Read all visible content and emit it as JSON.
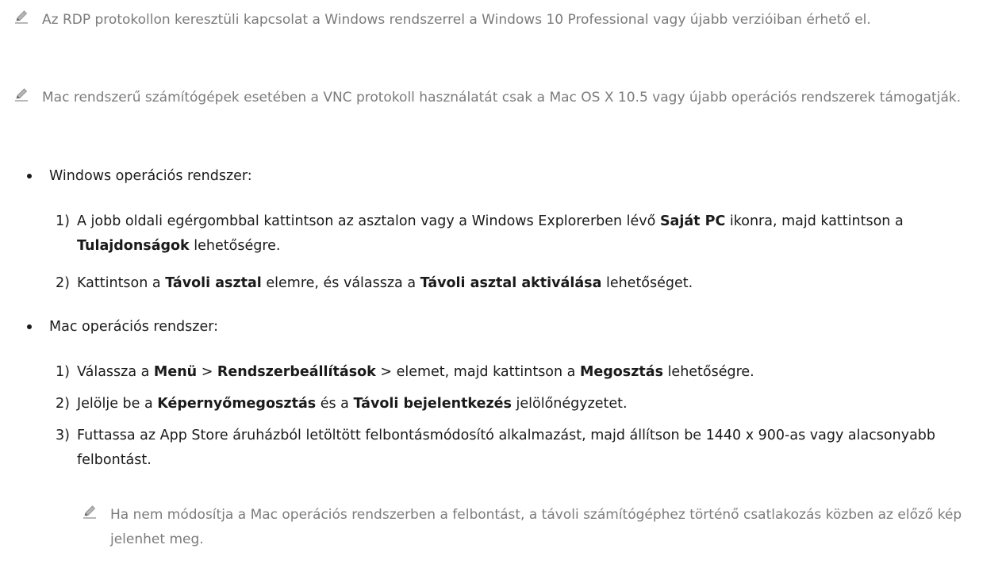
{
  "notes": {
    "rdp": "Az RDP protokollon keresztüli kapcsolat a Windows rendszerrel a Windows 10 Professional vagy újabb verzióiban érhető el.",
    "vnc": "Mac rendszerű számítógépek esetében a VNC protokoll használatát csak a Mac OS X 10.5 vagy újabb operációs rendszerek támogatják.",
    "resolution": "Ha nem módosítja a Mac operációs rendszerben a felbontást, a távoli számítógéphez történő csatlakozás közben az előző kép jelenhet meg."
  },
  "windows": {
    "heading": "Windows operációs rendszer:",
    "step1": {
      "num": "1)",
      "t1": "A jobb oldali egérgombbal kattintson az asztalon vagy a Windows Explorerben lévő ",
      "b1": "Saját PC",
      "t2": " ikonra, majd kattintson a ",
      "b2": "Tulajdonságok",
      "t3": " lehetőségre."
    },
    "step2": {
      "num": "2)",
      "t1": "Kattintson a ",
      "b1": "Távoli asztal",
      "t2": " elemre, és válassza a ",
      "b2": "Távoli asztal aktiválása",
      "t3": " lehetőséget."
    }
  },
  "mac": {
    "heading": "Mac operációs rendszer:",
    "step1": {
      "num": "1)",
      "t1": "Válassza a ",
      "b1": "Menü",
      "t2": " > ",
      "b2": "Rendszerbeállítások",
      "t3": " > elemet, majd kattintson a ",
      "b3": "Megosztás",
      "t4": " lehetőségre."
    },
    "step2": {
      "num": "2)",
      "t1": "Jelölje be a ",
      "b1": "Képernyőmegosztás",
      "t2": " és a ",
      "b2": "Távoli bejelentkezés",
      "t3": " jelölőnégyzetet."
    },
    "step3": {
      "num": "3)",
      "t1": "Futtassa az App Store áruházból letöltött felbontásmódosító alkalmazást, majd állítson be 1440 x 900-as vagy alacsonyabb felbontást."
    }
  },
  "colors": {
    "note_text": "#7b7b7b",
    "body_text": "#1a1a1a",
    "pen_icon": "#9a9a9a"
  }
}
